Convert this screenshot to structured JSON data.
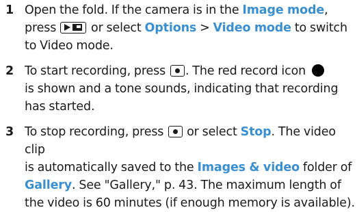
{
  "steps": [
    {
      "number": "1",
      "t1": "Open the fold. If the camera is in the ",
      "k1": "Image mode",
      "t2": ",",
      "t3": "press ",
      "t4": " or select ",
      "k2": "Options",
      "t5": " > ",
      "k3": "Video mode",
      "t6": " to switch",
      "t7": "to Video mode."
    },
    {
      "number": "2",
      "t1": "To start recording, press ",
      "t2": ". The red record icon ",
      "t3": "is shown and a tone sounds, indicating that recording",
      "t4": "has started."
    },
    {
      "number": "3",
      "t1": "To stop recording, press ",
      "t2": " or select ",
      "k1": "Stop",
      "t3": ". The video clip",
      "t4": "is automatically saved to the ",
      "k2": "Images & video",
      "t5": " folder of",
      "k3": "Gallery",
      "t6": ". See \"Gallery,\" p. 43. The maximum length of",
      "t7": "the video is 60 minutes (if enough memory is available)."
    }
  ],
  "icons": {
    "mode_key": "camera-mode-key-icon",
    "capture_key": "capture-key-icon",
    "record": "red-record-icon"
  },
  "colors": {
    "keyword": "#3a8fd1",
    "text": "#1a1a1a"
  }
}
